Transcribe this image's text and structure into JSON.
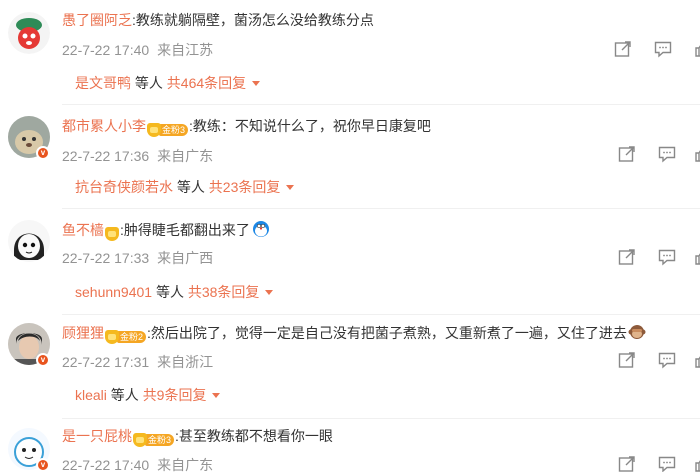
{
  "comments": [
    {
      "username": "愚了圈阿乏",
      "fan_level": "",
      "text": ":教练就躺隔壁，菌汤怎么没给教练分点",
      "emoji": "",
      "time": "22-7-22 17:40",
      "location": "来自江苏",
      "reply_user": "是文哥鸭",
      "reply_mid": " 等人 ",
      "reply_count": "共464条回复"
    },
    {
      "username": "都市累人小李",
      "fan_level": "金粉3",
      "text": ":教练：不知说什么了，祝你早日康复吧",
      "emoji": "",
      "time": "22-7-22 17:36",
      "location": "来自广东",
      "reply_user": "抗台奇侠颜若水",
      "reply_mid": " 等人 ",
      "reply_count": "共23条回复"
    },
    {
      "username": "鱼不樯",
      "fan_level": "",
      "text": ":肿得睫毛都翻出来了",
      "emoji": "doraemon-emoji",
      "time": "22-7-22 17:33",
      "location": "来自广西",
      "reply_user": "sehunn9401",
      "reply_mid": " 等人 ",
      "reply_count": "共38条回复"
    },
    {
      "username": "顾狸狸",
      "fan_level": "金粉2",
      "text": ":然后出院了，觉得一定是自己没有把菌子煮熟，又重新煮了一遍，又住了进去",
      "emoji": "monkey-emoji",
      "time": "22-7-22 17:31",
      "location": "来自浙江",
      "reply_user": "kleali",
      "reply_mid": " 等人 ",
      "reply_count": "共9条回复"
    },
    {
      "username": "是一只屁桃",
      "fan_level": "金粉3",
      "text": ":甚至教练都不想看你一眼",
      "emoji": "",
      "time": "22-7-22 17:40",
      "location": "来自广东",
      "reply_user": "",
      "reply_mid": "",
      "reply_count": ""
    }
  ],
  "colors": {
    "accent": "#eb7350",
    "meta": "#939393",
    "badge": "#e8541e",
    "fan": "#f5a623"
  },
  "icons": [
    "share-icon",
    "comment-icon",
    "like-icon"
  ]
}
